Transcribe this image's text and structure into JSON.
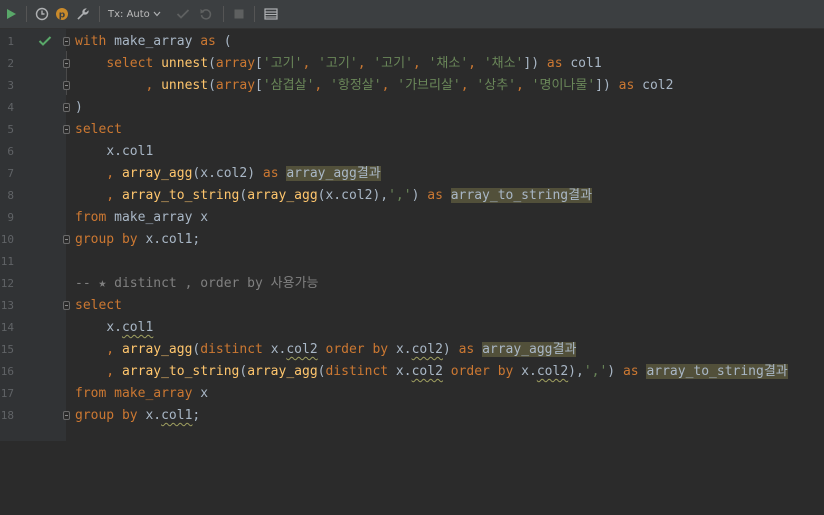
{
  "toolbar": {
    "tx_label": "Tx: Auto"
  },
  "gutter": {
    "line_numbers": [
      "1",
      "2",
      "3",
      "4",
      "5",
      "6",
      "7",
      "8",
      "9",
      "10",
      "11",
      "12",
      "13",
      "14",
      "15",
      "16",
      "17",
      "18"
    ]
  },
  "code": {
    "l1": {
      "kw1": "with",
      "t1": " make_array ",
      "kw2": "as",
      "t2": " ("
    },
    "l2": {
      "indent": "    ",
      "kw1": "select",
      "t1": " ",
      "fn1": "unnest",
      "t2": "(",
      "kw2": "array",
      "t3": "[",
      "s1": "'고기'",
      "c1": ", ",
      "s2": "'고기'",
      "c2": ", ",
      "s3": "'고기'",
      "c3": ", ",
      "s4": "'채소'",
      "c4": ", ",
      "s5": "'채소'",
      "t4": "]) ",
      "kw3": "as",
      "t5": " col1"
    },
    "l3": {
      "indent": "         , ",
      "fn1": "unnest",
      "t1": "(",
      "kw1": "array",
      "t2": "[",
      "s1": "'삼겹살'",
      "c1": ", ",
      "s2": "'항정살'",
      "c2": ", ",
      "s3": "'가브리살'",
      "c3": ", ",
      "s4": "'상추'",
      "c4": ", ",
      "s5": "'명이나물'",
      "t3": "]) ",
      "kw2": "as",
      "t4": " col2"
    },
    "l4": {
      "t1": ")"
    },
    "l5": {
      "kw1": "select"
    },
    "l6": {
      "indent": "    ",
      "t1": "x.col1"
    },
    "l7": {
      "indent": "    , ",
      "fn1": "array_agg",
      "t1": "(x.col2) ",
      "kw1": "as",
      "t2": " ",
      "hl": "array_agg결과"
    },
    "l8": {
      "indent": "    , ",
      "fn1": "array_to_string",
      "t1": "(",
      "fn2": "array_agg",
      "t2": "(x.col2),",
      "s1": "','",
      "t3": ") ",
      "kw1": "as",
      "t4": " ",
      "hl": "array_to_string결과"
    },
    "l9": {
      "kw1": "from",
      "t1": " make_array x"
    },
    "l10": {
      "kw1": "group by",
      "t1": " x.col1;"
    },
    "l12": {
      "cm": "-- ★ distinct , order by 사용가능"
    },
    "l13": {
      "kw1": "select"
    },
    "l14": {
      "indent": "    ",
      "t1": "x.",
      "w1": "col1"
    },
    "l15": {
      "indent": "    , ",
      "fn1": "array_agg",
      "t1": "(",
      "kw1": "distinct",
      "t2": " x.",
      "w1": "col2",
      "t3": " ",
      "kw2": "order by",
      "t4": " x.",
      "w2": "col2",
      "t5": ") ",
      "kw3": "as",
      "t6": " ",
      "hl": "array_agg결과"
    },
    "l16": {
      "indent": "    , ",
      "fn1": "array_to_string",
      "t1": "(",
      "fn2": "array_agg",
      "t2": "(",
      "kw1": "distinct",
      "t3": " x.",
      "w1": "col2",
      "t4": " ",
      "kw2": "order by",
      "t5": " x.",
      "w2": "col2",
      "t6": "),",
      "s1": "','",
      "t7": ") ",
      "kw3": "as",
      "t8": " ",
      "hl": "array_to_string결과"
    },
    "l17": {
      "kw1": "from",
      "t1": " ",
      "kw2": "make_array",
      "t2": " x"
    },
    "l18": {
      "kw1": "group by",
      "t1": " x.",
      "w1": "col1",
      "t2": ";"
    }
  }
}
